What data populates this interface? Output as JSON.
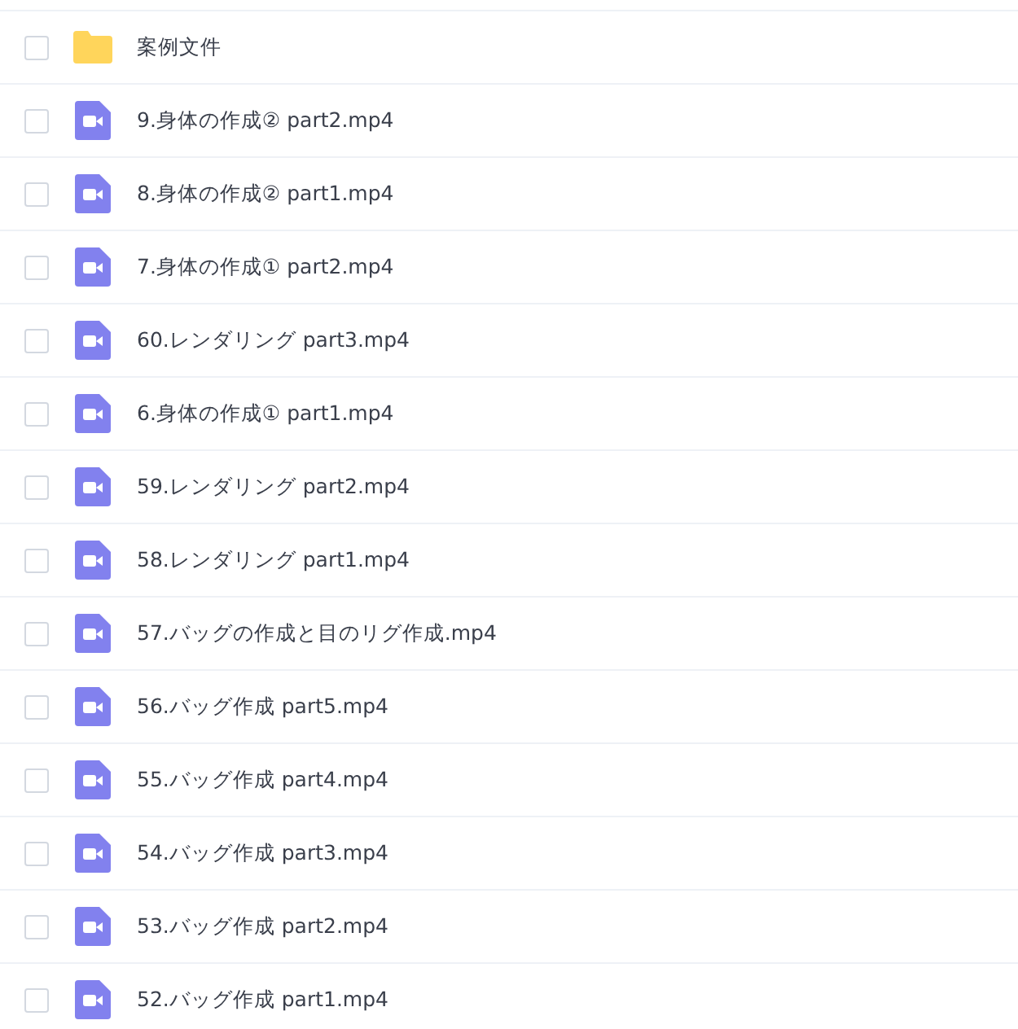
{
  "files": [
    {
      "kind": "folder",
      "name": "案例文件",
      "checked": false
    },
    {
      "kind": "video",
      "name": "9.身体の作成② part2.mp4",
      "checked": false
    },
    {
      "kind": "video",
      "name": "8.身体の作成② part1.mp4",
      "checked": false
    },
    {
      "kind": "video",
      "name": "7.身体の作成① part2.mp4",
      "checked": false
    },
    {
      "kind": "video",
      "name": "60.レンダリング part3.mp4",
      "checked": false
    },
    {
      "kind": "video",
      "name": "6.身体の作成① part1.mp4",
      "checked": false
    },
    {
      "kind": "video",
      "name": "59.レンダリング part2.mp4",
      "checked": false
    },
    {
      "kind": "video",
      "name": "58.レンダリング part1.mp4",
      "checked": false
    },
    {
      "kind": "video",
      "name": "57.バッグの作成と目のリグ作成.mp4",
      "checked": false
    },
    {
      "kind": "video",
      "name": "56.バッグ作成 part5.mp4",
      "checked": false
    },
    {
      "kind": "video",
      "name": "55.バッグ作成 part4.mp4",
      "checked": false
    },
    {
      "kind": "video",
      "name": "54.バッグ作成 part3.mp4",
      "checked": false
    },
    {
      "kind": "video",
      "name": "53.バッグ作成 part2.mp4",
      "checked": false
    },
    {
      "kind": "video",
      "name": "52.バッグ作成 part1.mp4",
      "checked": false
    }
  ]
}
